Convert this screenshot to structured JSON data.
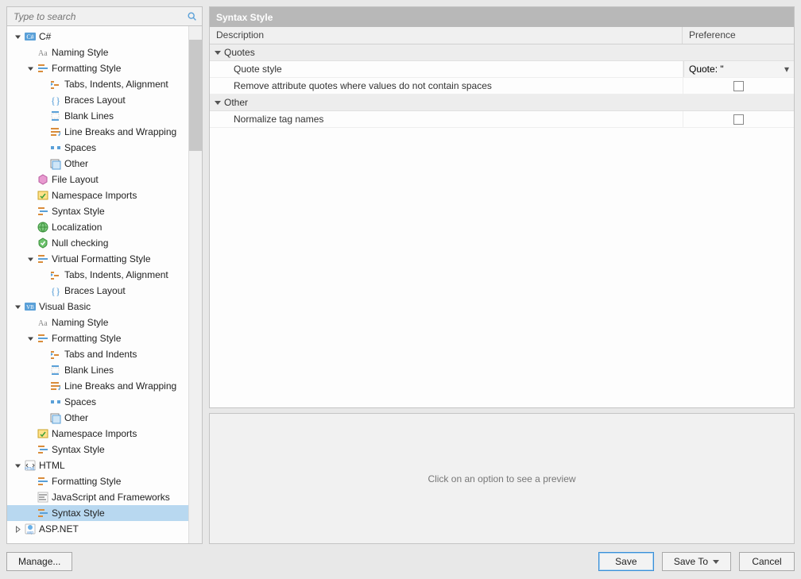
{
  "search": {
    "placeholder": "Type to search"
  },
  "tree": [
    {
      "depth": 1,
      "expand": "open",
      "icon": "csharp",
      "label": "C#"
    },
    {
      "depth": 2,
      "expand": "none",
      "icon": "naming",
      "label": "Naming Style"
    },
    {
      "depth": 2,
      "expand": "open",
      "icon": "formatting",
      "label": "Formatting Style"
    },
    {
      "depth": 3,
      "expand": "none",
      "icon": "tabs",
      "label": "Tabs, Indents, Alignment"
    },
    {
      "depth": 3,
      "expand": "none",
      "icon": "braces",
      "label": "Braces Layout"
    },
    {
      "depth": 3,
      "expand": "none",
      "icon": "blank",
      "label": "Blank Lines"
    },
    {
      "depth": 3,
      "expand": "none",
      "icon": "wrap",
      "label": "Line Breaks and Wrapping"
    },
    {
      "depth": 3,
      "expand": "none",
      "icon": "spaces",
      "label": "Spaces"
    },
    {
      "depth": 3,
      "expand": "none",
      "icon": "other",
      "label": "Other"
    },
    {
      "depth": 2,
      "expand": "none",
      "icon": "layout",
      "label": "File Layout"
    },
    {
      "depth": 2,
      "expand": "none",
      "icon": "ns",
      "label": "Namespace Imports"
    },
    {
      "depth": 2,
      "expand": "none",
      "icon": "syntax",
      "label": "Syntax Style"
    },
    {
      "depth": 2,
      "expand": "none",
      "icon": "local",
      "label": "Localization"
    },
    {
      "depth": 2,
      "expand": "none",
      "icon": "null",
      "label": "Null checking"
    },
    {
      "depth": 2,
      "expand": "open",
      "icon": "formatting",
      "label": "Virtual Formatting Style"
    },
    {
      "depth": 3,
      "expand": "none",
      "icon": "tabs",
      "label": "Tabs, Indents, Alignment"
    },
    {
      "depth": 3,
      "expand": "none",
      "icon": "braces",
      "label": "Braces Layout"
    },
    {
      "depth": 1,
      "expand": "open",
      "icon": "vb",
      "label": "Visual Basic"
    },
    {
      "depth": 2,
      "expand": "none",
      "icon": "naming",
      "label": "Naming Style"
    },
    {
      "depth": 2,
      "expand": "open",
      "icon": "formatting",
      "label": "Formatting Style"
    },
    {
      "depth": 3,
      "expand": "none",
      "icon": "tabs",
      "label": "Tabs and Indents"
    },
    {
      "depth": 3,
      "expand": "none",
      "icon": "blank",
      "label": "Blank Lines"
    },
    {
      "depth": 3,
      "expand": "none",
      "icon": "wrap",
      "label": "Line Breaks and Wrapping"
    },
    {
      "depth": 3,
      "expand": "none",
      "icon": "spaces",
      "label": "Spaces"
    },
    {
      "depth": 3,
      "expand": "none",
      "icon": "other",
      "label": "Other"
    },
    {
      "depth": 2,
      "expand": "none",
      "icon": "ns",
      "label": "Namespace Imports"
    },
    {
      "depth": 2,
      "expand": "none",
      "icon": "syntax",
      "label": "Syntax Style"
    },
    {
      "depth": 1,
      "expand": "open",
      "icon": "html",
      "label": "HTML"
    },
    {
      "depth": 2,
      "expand": "none",
      "icon": "formatting",
      "label": "Formatting Style"
    },
    {
      "depth": 2,
      "expand": "none",
      "icon": "js",
      "label": "JavaScript and Frameworks"
    },
    {
      "depth": 2,
      "expand": "none",
      "icon": "syntax",
      "label": "Syntax Style",
      "selected": true
    },
    {
      "depth": 1,
      "expand": "closed",
      "icon": "asp",
      "label": "ASP.NET"
    }
  ],
  "panel": {
    "title": "Syntax Style",
    "col_desc": "Description",
    "col_pref": "Preference"
  },
  "rows": [
    {
      "type": "group",
      "label": "Quotes"
    },
    {
      "type": "opt",
      "label": "Quote style",
      "pref_type": "combo",
      "pref_value": "Quote: \""
    },
    {
      "type": "opt",
      "label": "Remove attribute quotes where values do not contain spaces",
      "pref_type": "check",
      "pref_checked": false
    },
    {
      "type": "group",
      "label": "Other"
    },
    {
      "type": "opt",
      "label": "Normalize tag names",
      "pref_type": "check",
      "pref_checked": false
    }
  ],
  "preview": {
    "placeholder": "Click on an option to see a preview"
  },
  "buttons": {
    "manage": "Manage...",
    "save": "Save",
    "saveto": "Save To",
    "cancel": "Cancel"
  }
}
